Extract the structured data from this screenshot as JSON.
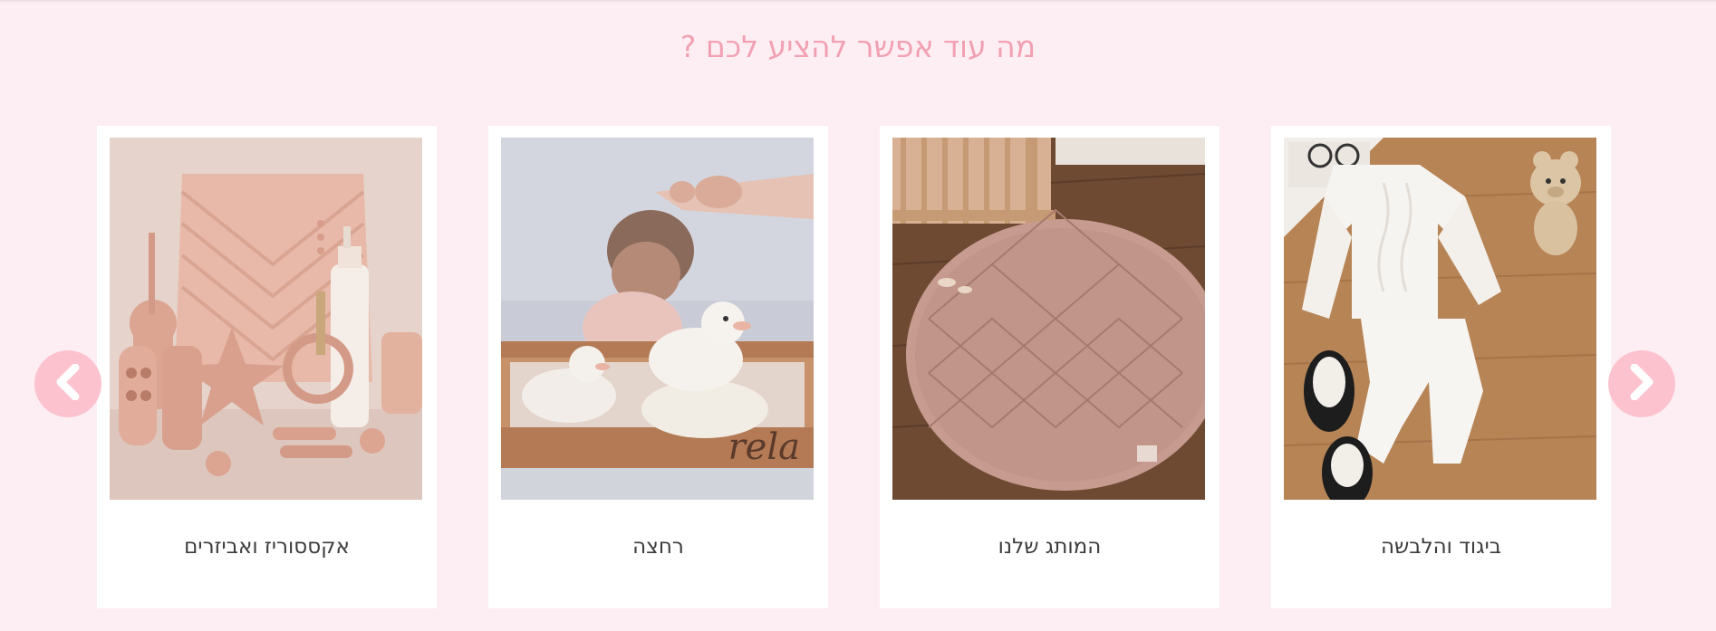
{
  "section": {
    "title": "מה עוד אפשר להציע לכם ?"
  },
  "carousel": {
    "items": [
      {
        "label": "אקססוריז ואביזרים",
        "image": "pink silicone baby accessories and quilted bag"
      },
      {
        "label": "רחצה",
        "image": "baby bath with rubber ducks on wooden tray"
      },
      {
        "label": "המותג שלנו",
        "image": "round quilted pink play mat by crib"
      },
      {
        "label": "ביגוד והלבשה",
        "image": "white knit baby outfit with sneakers and teddy"
      }
    ],
    "prev_icon": "chevron-left-icon",
    "next_icon": "chevron-right-icon"
  },
  "colors": {
    "background": "#fdeef3",
    "title": "#f2a1b3",
    "arrow": "#fcc3cf",
    "card": "#ffffff"
  }
}
